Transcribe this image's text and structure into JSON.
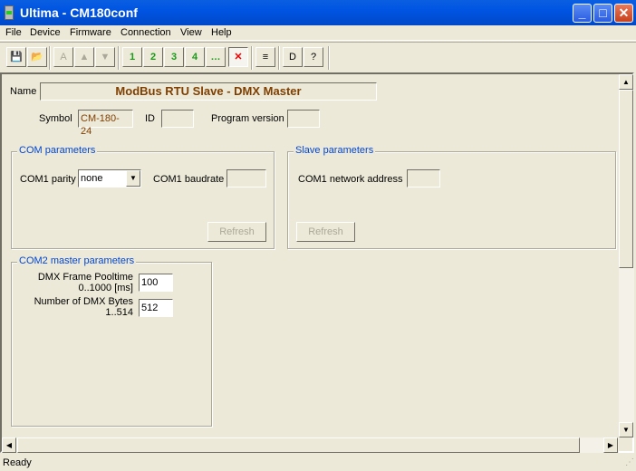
{
  "window": {
    "title": "Ultima - CM180conf",
    "minimize": "_",
    "maximize": "□",
    "close": "✕"
  },
  "menu": [
    "File",
    "Device",
    "Firmware",
    "Connection",
    "View",
    "Help"
  ],
  "toolbar": [
    {
      "icon": "save-icon",
      "glyph": "💾"
    },
    {
      "icon": "open-folder-icon",
      "glyph": "📂"
    },
    {
      "icon": "auto-icon",
      "glyph": "A",
      "disabled": true
    },
    {
      "icon": "upload-icon",
      "glyph": "▲",
      "disabled": true
    },
    {
      "icon": "download-icon",
      "glyph": "▼",
      "disabled": true
    },
    {
      "icon": "connect-1-icon",
      "glyph": "1"
    },
    {
      "icon": "connect-2-icon",
      "glyph": "2"
    },
    {
      "icon": "connect-3-icon",
      "glyph": "3"
    },
    {
      "icon": "connect-4-icon",
      "glyph": "4"
    },
    {
      "icon": "connect-auto-icon",
      "glyph": "…"
    },
    {
      "icon": "disconnect-icon",
      "glyph": "✕",
      "pressed": true
    },
    {
      "icon": "monitor-icon",
      "glyph": "≡"
    },
    {
      "icon": "doc-icon",
      "glyph": "D"
    },
    {
      "icon": "help-icon",
      "glyph": "?"
    }
  ],
  "form": {
    "name_label": "Name",
    "name_value": "ModBus RTU Slave - DMX Master",
    "symbol_label": "Symbol",
    "symbol_value": "CM-180-24",
    "id_label": "ID",
    "id_value": "",
    "program_version_label": "Program version",
    "program_version_value": "",
    "com_group": {
      "title": "COM parameters",
      "parity_label": "COM1 parity",
      "parity_value": "none",
      "baudrate_label": "COM1 baudrate",
      "baudrate_value": "",
      "refresh": "Refresh"
    },
    "slave_group": {
      "title": "Slave parameters",
      "address_label": "COM1 network address",
      "address_value": "",
      "refresh": "Refresh"
    },
    "com2_group": {
      "title": "COM2 master parameters",
      "pooltime_label1": "DMX Frame Pooltime",
      "pooltime_label2": "0..1000 [ms]",
      "pooltime_value": "100",
      "bytes_label1": "Number of DMX Bytes",
      "bytes_label2": "1..514",
      "bytes_value": "512"
    }
  },
  "status": {
    "text": "Ready"
  },
  "colors": {
    "title_bar": "#0054e3",
    "group_title": "#0046d5",
    "name_text": "#7f3f00"
  }
}
